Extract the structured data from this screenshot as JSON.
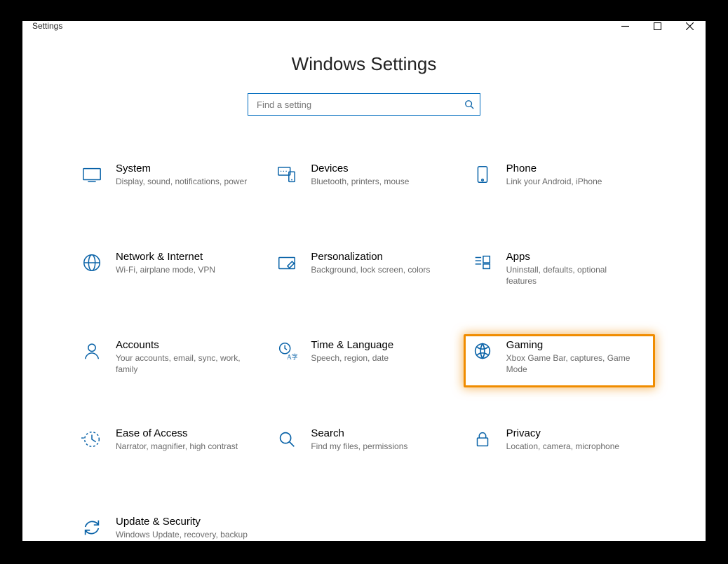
{
  "window": {
    "title": "Settings"
  },
  "page": {
    "heading": "Windows Settings",
    "search_placeholder": "Find a setting"
  },
  "categories": [
    {
      "id": "system",
      "title": "System",
      "desc": "Display, sound, notifications, power",
      "icon": "monitor-icon",
      "highlighted": false
    },
    {
      "id": "devices",
      "title": "Devices",
      "desc": "Bluetooth, printers, mouse",
      "icon": "devices-icon",
      "highlighted": false
    },
    {
      "id": "phone",
      "title": "Phone",
      "desc": "Link your Android, iPhone",
      "icon": "phone-icon",
      "highlighted": false
    },
    {
      "id": "network",
      "title": "Network & Internet",
      "desc": "Wi-Fi, airplane mode, VPN",
      "icon": "globe-icon",
      "highlighted": false
    },
    {
      "id": "personalization",
      "title": "Personalization",
      "desc": "Background, lock screen, colors",
      "icon": "personalize-icon",
      "highlighted": false
    },
    {
      "id": "apps",
      "title": "Apps",
      "desc": "Uninstall, defaults, optional features",
      "icon": "apps-icon",
      "highlighted": false
    },
    {
      "id": "accounts",
      "title": "Accounts",
      "desc": "Your accounts, email, sync, work, family",
      "icon": "person-icon",
      "highlighted": false
    },
    {
      "id": "time",
      "title": "Time & Language",
      "desc": "Speech, region, date",
      "icon": "clock-lang-icon",
      "highlighted": false
    },
    {
      "id": "gaming",
      "title": "Gaming",
      "desc": "Xbox Game Bar, captures, Game Mode",
      "icon": "gaming-icon",
      "highlighted": true
    },
    {
      "id": "ease",
      "title": "Ease of Access",
      "desc": "Narrator, magnifier, high contrast",
      "icon": "ease-icon",
      "highlighted": false
    },
    {
      "id": "search",
      "title": "Search",
      "desc": "Find my files, permissions",
      "icon": "search-icon",
      "highlighted": false
    },
    {
      "id": "privacy",
      "title": "Privacy",
      "desc": "Location, camera, microphone",
      "icon": "lock-icon",
      "highlighted": false
    },
    {
      "id": "update",
      "title": "Update & Security",
      "desc": "Windows Update, recovery, backup",
      "icon": "update-icon",
      "highlighted": false
    }
  ],
  "colors": {
    "accent": "#0a63a8",
    "highlight": "#f08c00"
  }
}
